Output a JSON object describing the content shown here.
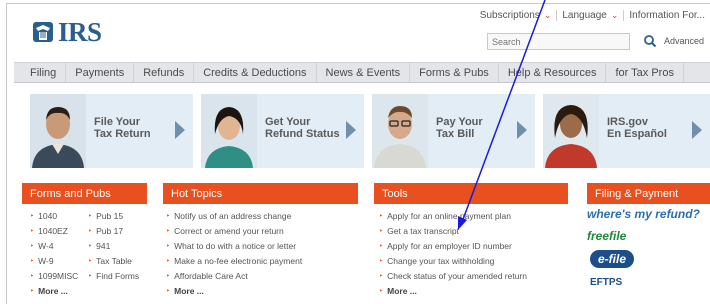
{
  "header": {
    "logo_text": "IRS",
    "top_links": [
      {
        "label": "Subscriptions"
      },
      {
        "label": "Language"
      },
      {
        "label": "Information For..."
      }
    ],
    "search_placeholder": "Search",
    "advanced_label": "Advanced"
  },
  "nav": {
    "items": [
      "Filing",
      "Payments",
      "Refunds",
      "Credits & Deductions",
      "News & Events",
      "Forms & Pubs",
      "Help & Resources",
      "for Tax Pros"
    ]
  },
  "promos": [
    {
      "label_line1": "File Your",
      "label_line2": "Tax Return"
    },
    {
      "label_line1": "Get Your",
      "label_line2": "Refund Status"
    },
    {
      "label_line1": "Pay Your",
      "label_line2": "Tax Bill"
    },
    {
      "label_line1": "IRS.gov",
      "label_line2": "En Español"
    }
  ],
  "forms_pubs": {
    "title": "Forms and Pubs",
    "col1": [
      "1040",
      "1040EZ",
      "W-4",
      "W-9",
      "1099MISC"
    ],
    "col2": [
      "Pub 15",
      "Pub 17",
      "941",
      "Tax Table",
      "Find Forms"
    ],
    "more": "More ..."
  },
  "hot_topics": {
    "title": "Hot Topics",
    "items": [
      "Notify us of an address change",
      "Correct or amend your return",
      "What to do with a notice or letter",
      "Make a no-fee electronic payment",
      "Affordable Care Act"
    ],
    "more": "More ..."
  },
  "tools": {
    "title": "Tools",
    "items": [
      "Apply for an online payment plan",
      "Get a tax transcript",
      "Apply for an employer ID number",
      "Change your tax withholding",
      "Check status of your amended return"
    ],
    "more": "More ..."
  },
  "filing_payment": {
    "title": "Filing & Payment",
    "logos": [
      "where's my refund?",
      "freefile",
      "e-file",
      "EFTPS"
    ]
  },
  "colors": {
    "brand_blue": "#2c5d8f",
    "section_orange": "#e8501f",
    "annotation_blue": "#1a1adc"
  }
}
